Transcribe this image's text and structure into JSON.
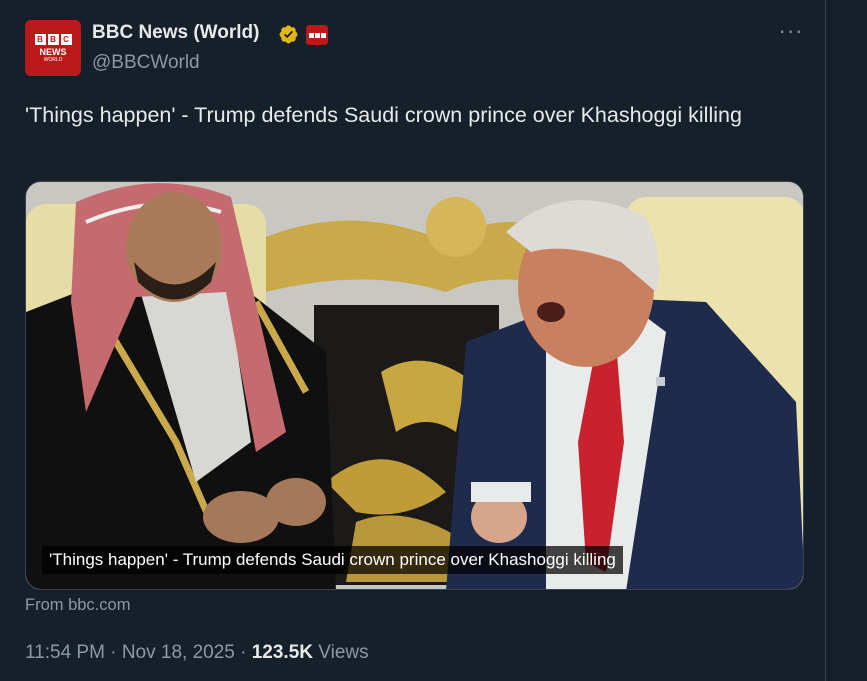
{
  "account": {
    "name": "BBC News (World)",
    "handle": "@BBCWorld",
    "avatar_text": {
      "blocks": [
        "B",
        "B",
        "C"
      ],
      "line1": "NEWS",
      "line2": "WORLD"
    },
    "verified_icon": "gold-verified-badge-icon",
    "affiliate_icon": "bbc-affiliate-badge-icon"
  },
  "menu": {
    "more_icon": "more-options-icon",
    "label": "···"
  },
  "tweet": {
    "text": "'Things happen' - Trump defends Saudi crown prince over Khashoggi killing"
  },
  "card": {
    "caption": "'Things happen' - Trump defends Saudi crown prince over Khashoggi killing",
    "source": "From bbc.com"
  },
  "meta": {
    "time": "11:54 PM",
    "separator": " · ",
    "date": "Nov 18, 2025",
    "views_count": "123.5K",
    "views_label": "Views"
  },
  "colors": {
    "background": "#15202b",
    "text_primary": "#e7e9ea",
    "text_secondary": "#8b98a5",
    "border": "#38444d",
    "bbc_red": "#bb1919",
    "verified_gold": "#e2b719"
  }
}
